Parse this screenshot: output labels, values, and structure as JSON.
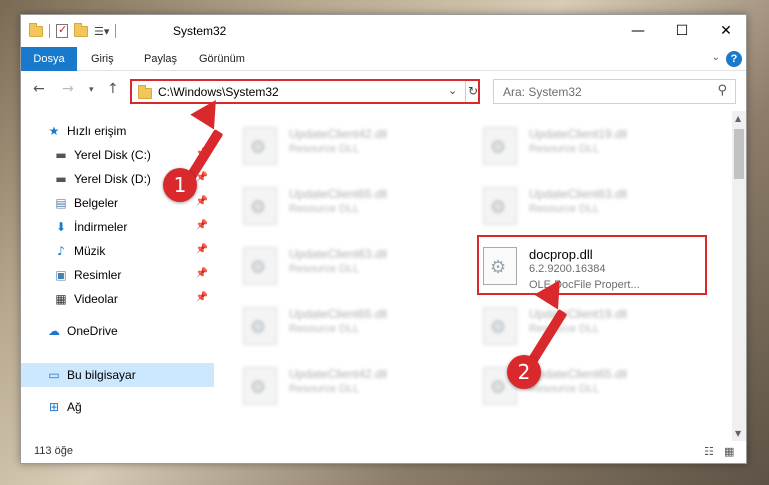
{
  "window": {
    "title": "System32"
  },
  "ribbon": {
    "tabs": [
      "Dosya",
      "Giriş",
      "Paylaş",
      "Görünüm"
    ]
  },
  "address": {
    "path": "C:\\Windows\\System32"
  },
  "search": {
    "placeholder": "Ara: System32"
  },
  "sidebar": {
    "items": [
      {
        "label": "Hızlı erişim",
        "icon": "star-icon"
      },
      {
        "label": "Yerel Disk (C:)",
        "icon": "drive-icon",
        "pinned": true
      },
      {
        "label": "Yerel Disk (D:)",
        "icon": "drive-icon",
        "pinned": true
      },
      {
        "label": "Belgeler",
        "icon": "document-icon",
        "pinned": true
      },
      {
        "label": "İndirmeler",
        "icon": "download-icon",
        "pinned": true
      },
      {
        "label": "Müzik",
        "icon": "music-icon",
        "pinned": true
      },
      {
        "label": "Resimler",
        "icon": "pictures-icon",
        "pinned": true
      },
      {
        "label": "Videolar",
        "icon": "video-icon",
        "pinned": true
      },
      {
        "label": "OneDrive",
        "icon": "cloud-icon"
      },
      {
        "label": "Bu bilgisayar",
        "icon": "computer-icon",
        "selected": true
      },
      {
        "label": "Ağ",
        "icon": "network-icon"
      }
    ]
  },
  "files": [
    {
      "name": "UpdateClient42.dll",
      "type": "Resource DLL"
    },
    {
      "name": "UpdateClient19.dll",
      "type": "Resource DLL"
    },
    {
      "name": "UpdateClient65.dll",
      "type": "Resource DLL"
    },
    {
      "name": "UpdateClient63.dll",
      "type": "Resource DLL"
    },
    {
      "name": "UpdateClient63.dll",
      "type": "Resource DLL"
    },
    {
      "name": "docprop.dll",
      "version": "6.2.9200.16384",
      "type": "OLE DocFile Propert..."
    },
    {
      "name": "UpdateClient65.dll",
      "type": "Resource DLL"
    },
    {
      "name": "UpdateClient19.dll",
      "type": "Resource DLL"
    },
    {
      "name": "UpdateClient42.dll",
      "type": "Resource DLL"
    },
    {
      "name": "UpdateClient65.dll",
      "type": "Resource DLL"
    }
  ],
  "status": {
    "count": "113 öğe"
  },
  "annotations": {
    "step1": "1",
    "step2": "2"
  },
  "colors": {
    "accent": "#1979ca",
    "highlight": "#d9292c",
    "selected": "#cce8ff"
  }
}
